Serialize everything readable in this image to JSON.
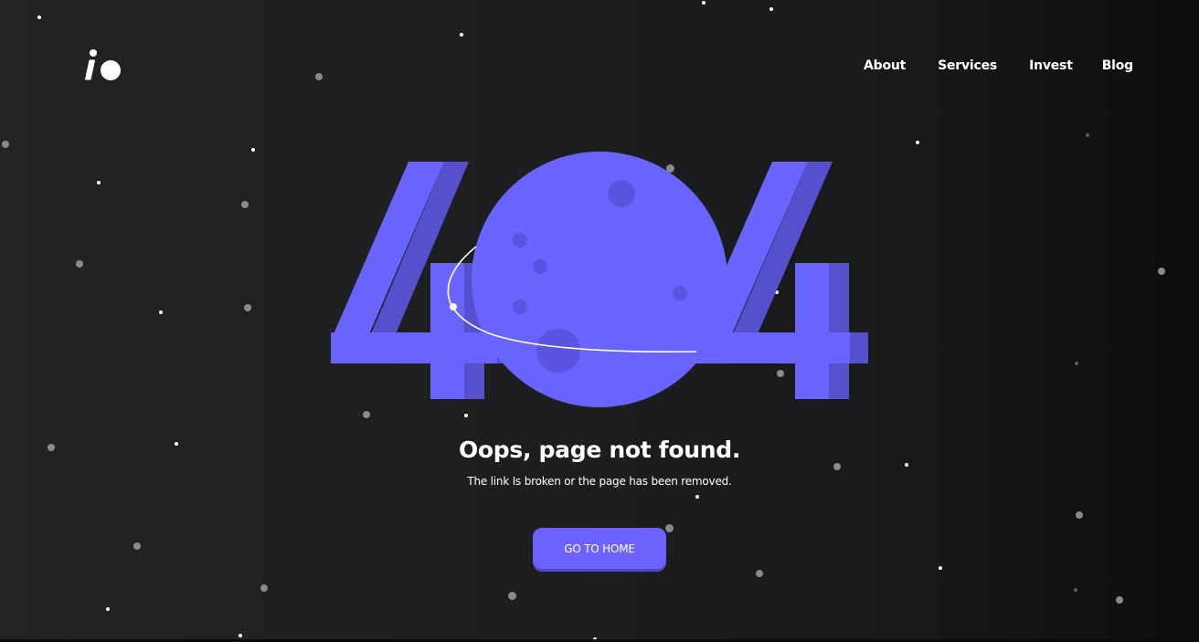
{
  "colors": {
    "accent": "#6c63ff",
    "background": "#1e1f21",
    "text": "#ffffff"
  },
  "header": {
    "logo_icon": "io-logo-icon",
    "nav": [
      {
        "label": "About"
      },
      {
        "label": "Services"
      },
      {
        "label": "Invest"
      },
      {
        "label": "Blog"
      }
    ]
  },
  "illustration": {
    "code": "404",
    "planet_icon": "planet-icon"
  },
  "main": {
    "headline": "Oops, page not found.",
    "subline": "The link Is broken or the page has been removed.",
    "button_label": "GO TO HOME"
  }
}
